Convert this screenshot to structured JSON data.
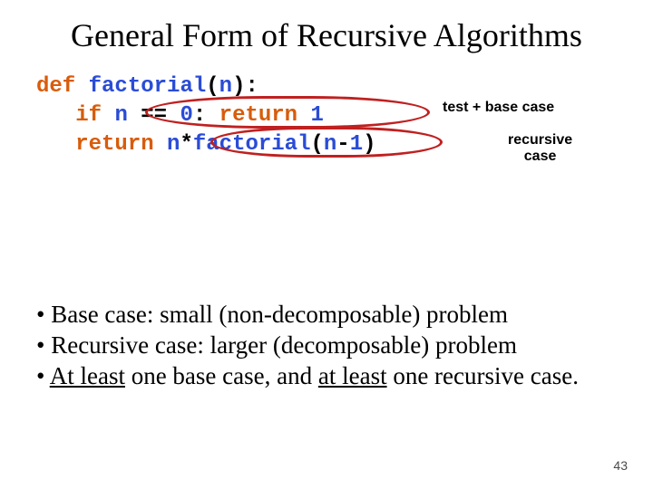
{
  "title": "General Form of Recursive Algorithms",
  "code": {
    "def": "def",
    "fn": "factorial",
    "lpar": "(",
    "n": "n",
    "rpar": ")",
    "colon": ":",
    "if": "if",
    "eq": " == ",
    "zero": "0",
    "c2": ":",
    "ret": "return",
    "one": "1",
    "ret2": "return",
    "star": "*",
    "minus": "-",
    "one2": "1"
  },
  "labels": {
    "l1": "test + base case",
    "l2a": "recursive",
    "l2b": "case"
  },
  "bullets": {
    "b1": "•  Base case:  small (non-decomposable) problem",
    "b2": "•  Recursive case: larger (decomposable) problem",
    "b3a": "•  ",
    "b3_ul1": "At least",
    "b3b": " one base case, and ",
    "b3_ul2": "at least",
    "b3c": " one recursive case."
  },
  "page": "43"
}
